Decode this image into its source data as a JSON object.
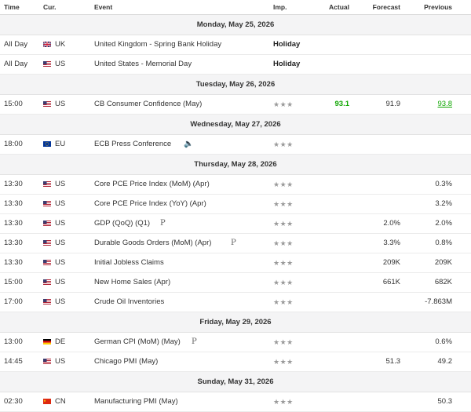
{
  "columns": {
    "time": "Time",
    "cur": "Cur.",
    "event": "Event",
    "imp": "Imp.",
    "actual": "Actual",
    "forecast": "Forecast",
    "previous": "Previous"
  },
  "days": [
    {
      "date": "Monday, May 25, 2026",
      "events": [
        {
          "time": "All Day",
          "flag": "uk",
          "currency": "UK",
          "event": "United Kingdom - Spring Bank Holiday",
          "holiday": "Holiday"
        },
        {
          "time": "All Day",
          "flag": "us",
          "currency": "US",
          "event": "United States - Memorial Day",
          "holiday": "Holiday"
        }
      ]
    },
    {
      "date": "Tuesday, May 26, 2026",
      "events": [
        {
          "time": "15:00",
          "flag": "us",
          "currency": "US",
          "event": "CB Consumer Confidence  (May)",
          "importance": "★★★",
          "actual": "93.1",
          "actual_style": "green",
          "forecast": "91.9",
          "previous": "93.8",
          "previous_style": "green-link"
        }
      ]
    },
    {
      "date": "Wednesday, May 27, 2026",
      "events": [
        {
          "time": "18:00",
          "flag": "eu",
          "currency": "EU",
          "event": "ECB Press Conference",
          "icon": "speaker",
          "importance": "★★★"
        }
      ]
    },
    {
      "date": "Thursday, May 28, 2026",
      "events": [
        {
          "time": "13:30",
          "flag": "us",
          "currency": "US",
          "event": "Core PCE Price Index (MoM) (Apr)",
          "importance": "★★★",
          "previous": "0.3%"
        },
        {
          "time": "13:30",
          "flag": "us",
          "currency": "US",
          "event": "Core PCE Price Index (YoY) (Apr)",
          "importance": "★★★",
          "previous": "3.2%"
        },
        {
          "time": "13:30",
          "flag": "us",
          "currency": "US",
          "event": "GDP (QoQ) (Q1)",
          "icon": "P",
          "importance": "★★★",
          "forecast": "2.0%",
          "previous": "2.0%"
        },
        {
          "time": "13:30",
          "flag": "us",
          "currency": "US",
          "event": "Durable Goods Orders (MoM) (Apr)",
          "icon": "P",
          "importance": "★★★",
          "forecast": "3.3%",
          "previous": "0.8%"
        },
        {
          "time": "13:30",
          "flag": "us",
          "currency": "US",
          "event": "Initial Jobless Claims",
          "importance": "★★★",
          "forecast": "209K",
          "previous": "209K"
        },
        {
          "time": "15:00",
          "flag": "us",
          "currency": "US",
          "event": "New Home Sales  (Apr)",
          "importance": "★★★",
          "forecast": "661K",
          "previous": "682K"
        },
        {
          "time": "17:00",
          "flag": "us",
          "currency": "US",
          "event": "Crude Oil Inventories",
          "importance": "★★★",
          "previous": "-7.863M"
        }
      ]
    },
    {
      "date": "Friday, May 29, 2026",
      "events": [
        {
          "time": "13:00",
          "flag": "de",
          "currency": "DE",
          "event": "German CPI (MoM) (May)",
          "icon": "P",
          "importance": "★★★",
          "previous": "0.6%"
        },
        {
          "time": "14:45",
          "flag": "us",
          "currency": "US",
          "event": "Chicago PMI  (May)",
          "importance": "★★★",
          "forecast": "51.3",
          "previous": "49.2"
        }
      ]
    },
    {
      "date": "Sunday, May 31, 2026",
      "events": [
        {
          "time": "02:30",
          "flag": "cn",
          "currency": "CN",
          "event": "Manufacturing PMI  (May)",
          "importance": "★★★",
          "previous": "50.3"
        }
      ]
    }
  ]
}
